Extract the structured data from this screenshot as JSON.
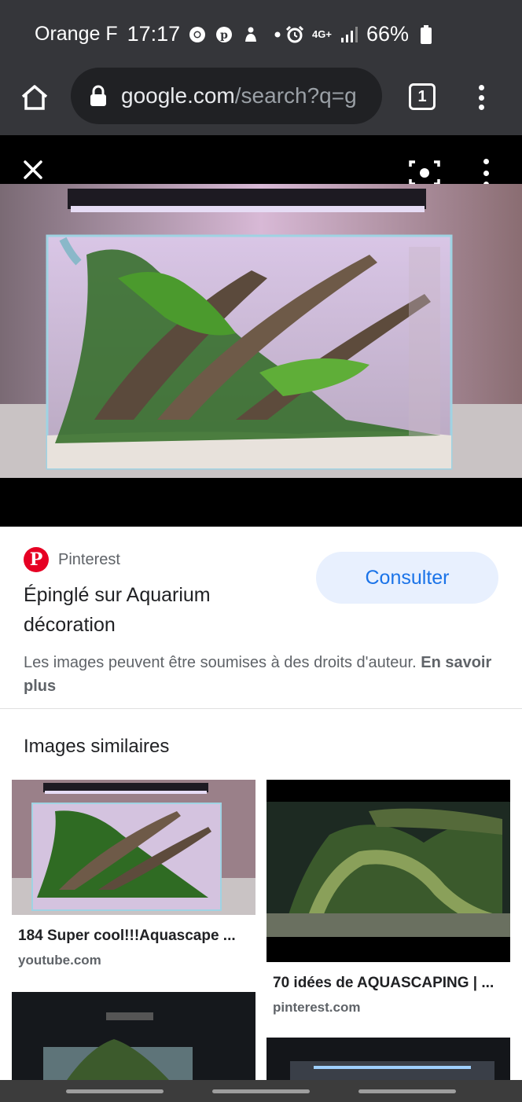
{
  "status_bar": {
    "carrier": "Orange F",
    "time": "17:17",
    "network": "4G+",
    "battery": "66%",
    "icons": [
      "chrome-icon",
      "pinterest-icon",
      "notification-icon",
      "dot-icon",
      "alarm-icon",
      "signal-icon",
      "battery-icon"
    ]
  },
  "browser": {
    "url_host": "google.com",
    "url_path": "/search?q=g",
    "tab_count": "1"
  },
  "viewer": {
    "image_alt": "Aquascape aquarium"
  },
  "result": {
    "source": "Pinterest",
    "title": "Épinglé sur Aquarium décoration",
    "visit_label": "Consulter",
    "rights_text": "Les images peuvent être soumises à des droits d'auteur.",
    "rights_link": "En savoir plus"
  },
  "similar": {
    "heading": "Images similaires",
    "items": [
      {
        "title": "184 Super cool!!!Aquascape ...",
        "site": "youtube.com"
      },
      {
        "title": "70 idées de AQUASCAPING | ...",
        "site": "pinterest.com"
      },
      {
        "title": "",
        "site": ""
      },
      {
        "title": "",
        "site": ""
      }
    ]
  },
  "colors": {
    "chrome_bar": "#35363a",
    "pinterest_red": "#e60023",
    "button_bg": "#e8f0fe",
    "button_text": "#1a73e8"
  }
}
